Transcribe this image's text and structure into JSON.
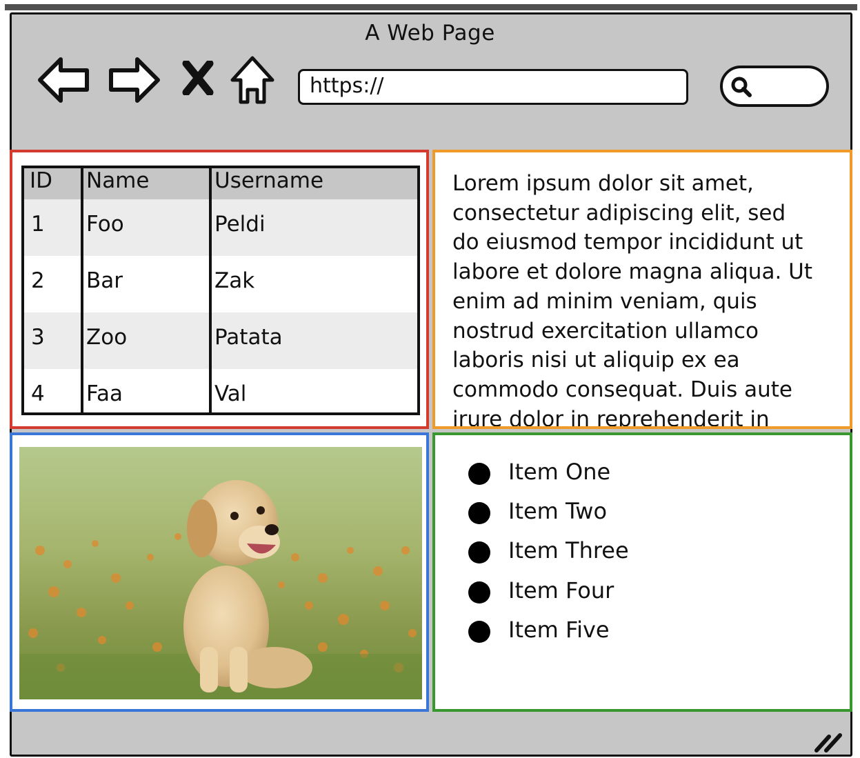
{
  "window": {
    "title": "A Web Page"
  },
  "toolbar": {
    "back_icon": "arrow-left-icon",
    "forward_icon": "arrow-right-icon",
    "stop_icon": "x-icon",
    "home_icon": "home-icon",
    "url": "https://",
    "search_icon": "search-icon"
  },
  "table": {
    "columns": [
      "ID",
      "Name",
      "Username"
    ],
    "rows": [
      [
        "1",
        "Foo",
        "Peldi"
      ],
      [
        "2",
        "Bar",
        "Zak"
      ],
      [
        "3",
        "Zoo",
        "Patata"
      ],
      [
        "4",
        "Faa",
        "Val"
      ]
    ]
  },
  "text_panel": {
    "lines": [
      "Lorem ipsum dolor sit amet,",
      "consectetur adipiscing elit, sed",
      "do eiusmod tempor incididunt ut",
      "labore et dolore magna aliqua. Ut",
      "enim ad minim veniam, quis",
      "nostrud exercitation ullamco",
      "laboris nisi ut aliquip ex ea",
      "commodo consequat. Duis aute",
      "irure dolor in reprehenderit in"
    ]
  },
  "list": {
    "items": [
      "Item One",
      "Item Two",
      "Item Three",
      "Item Four",
      "Item Five"
    ]
  },
  "colors": {
    "table_panel_border": "#d33b2f",
    "text_panel_border": "#f09a2a",
    "image_panel_border": "#3a76d8",
    "list_panel_border": "#38982f",
    "chrome_gray": "#c6c6c6"
  }
}
